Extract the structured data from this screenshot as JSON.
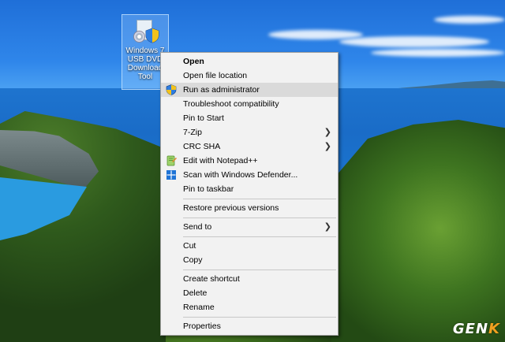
{
  "desktop": {
    "icon_label": "Windows 7\nUSB DVD\nDownload\nTool",
    "logo": {
      "main": "GEN",
      "accent": "K"
    }
  },
  "context_menu": {
    "items": [
      {
        "label": "Open",
        "bold": true
      },
      {
        "label": "Open file location"
      },
      {
        "label": "Run as administrator",
        "icon": "uac-shield-icon",
        "highlighted": true
      },
      {
        "label": "Troubleshoot compatibility"
      },
      {
        "label": "Pin to Start"
      },
      {
        "label": "7-Zip",
        "submenu": true
      },
      {
        "label": "CRC SHA",
        "submenu": true
      },
      {
        "label": "Edit with Notepad++",
        "icon": "notepad-plus-plus-icon"
      },
      {
        "label": "Scan with Windows Defender...",
        "icon": "windows-defender-icon"
      },
      {
        "label": "Pin to taskbar"
      },
      {
        "label": "Restore previous versions"
      },
      {
        "label": "Send to",
        "submenu": true
      },
      {
        "label": "Cut"
      },
      {
        "label": "Copy"
      },
      {
        "label": "Create shortcut"
      },
      {
        "label": "Delete"
      },
      {
        "label": "Rename"
      },
      {
        "label": "Properties"
      }
    ]
  },
  "colors": {
    "menu_bg": "#f2f2f2",
    "highlight": "#dadada",
    "separator": "#c8c8c8",
    "logo_accent": "#f0a020"
  }
}
